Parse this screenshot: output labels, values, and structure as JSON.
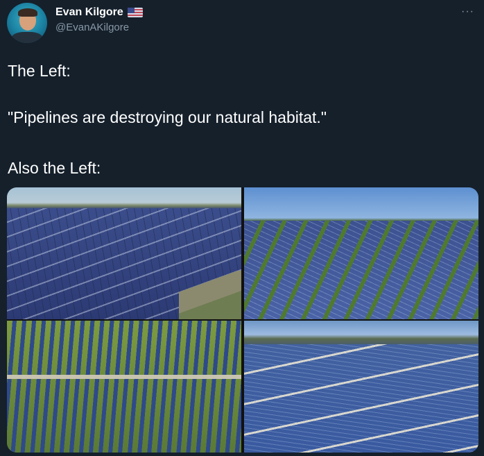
{
  "author": {
    "display_name": "Evan Kilgore",
    "handle": "@EvanAKilgore",
    "flag": "us-flag-icon"
  },
  "menu": {
    "more_label": "···"
  },
  "tweet": {
    "line1": "The Left:",
    "line2": "\"Pipelines are destroying our natural habitat.\"",
    "line3": "Also the Left:"
  },
  "media": {
    "photos": [
      "solar-farm-photo-1",
      "solar-farm-photo-2",
      "solar-farm-photo-3",
      "solar-farm-photo-4"
    ]
  },
  "colors": {
    "background": "#15202b",
    "secondary_text": "#8899a6"
  }
}
